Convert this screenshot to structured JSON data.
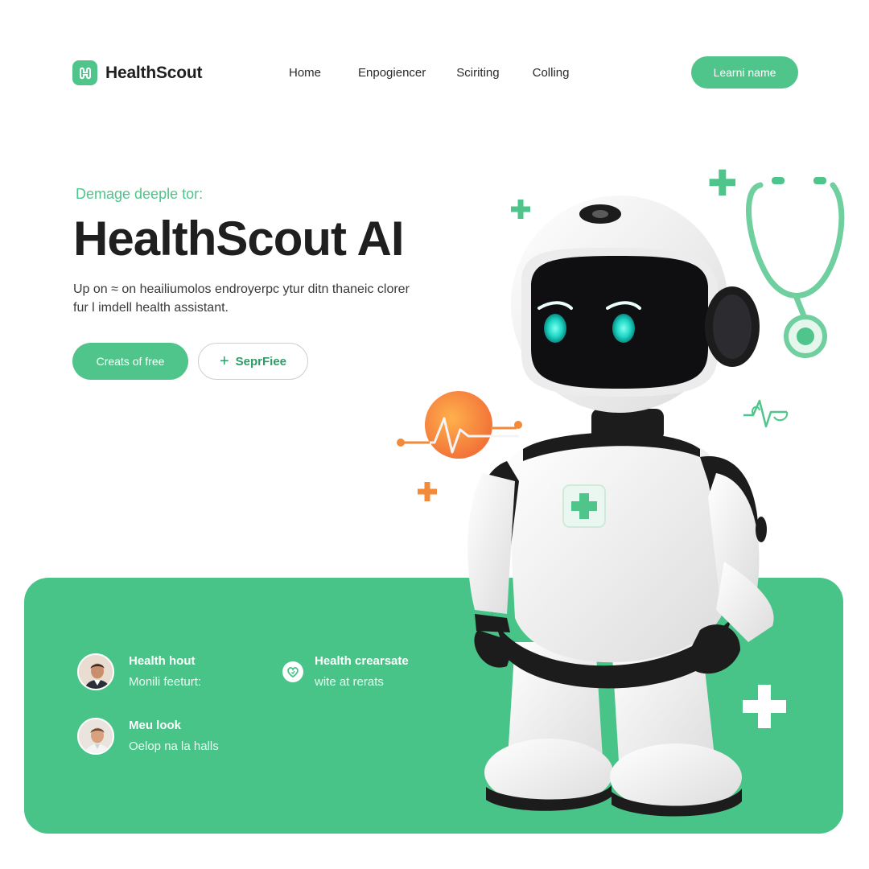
{
  "brand": {
    "name": "HealthScout",
    "logo_icon": "medical-logo-icon"
  },
  "nav": {
    "links": [
      "Home",
      "Enpogiencer",
      "Sciriting",
      "Colling"
    ],
    "cta_label": "Learni name"
  },
  "hero": {
    "eyebrow": "Demage deeple tor:",
    "title": "HealthScout AI",
    "description_line1": "Up on ≈ on heailiumolos  endroyerpc ytur ditn thaneic clorer",
    "description_line2": "fur l imdell health assistant.",
    "primary_button": "Creats of free",
    "secondary_button": "SeprFiee"
  },
  "features": [
    {
      "title": "Health hout",
      "subtitle": "Monili feeturt:",
      "icon": "avatar"
    },
    {
      "title": "Health crearsate",
      "subtitle": "wite at rerats",
      "icon": "heart-icon"
    },
    {
      "title": "Meu look",
      "subtitle": "Oelop na la halls",
      "icon": "avatar"
    }
  ],
  "colors": {
    "accent": "#4fc58c",
    "panel": "#48c488",
    "heartbeat_orange": "#f28a3a",
    "text": "#1f1f1f"
  }
}
